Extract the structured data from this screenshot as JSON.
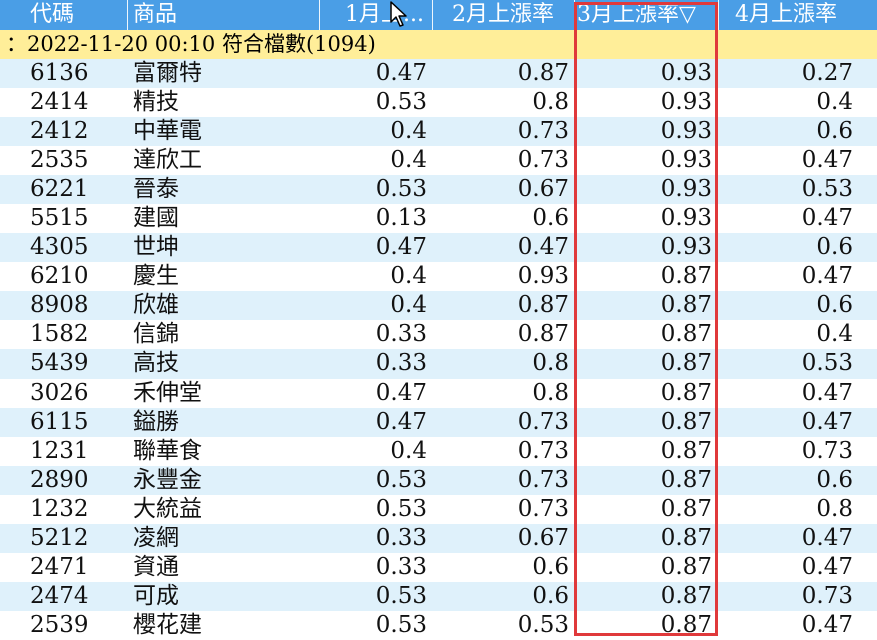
{
  "columns": {
    "code": "代碼",
    "name": "商品",
    "m1": "1月上...",
    "m2": "2月上漲率",
    "m3": "3月上漲率▽",
    "m4": "4月上漲率"
  },
  "banner": "：2022-11-20 00:10 符合檔數(1094)",
  "rows": [
    {
      "code": "6136",
      "name": "富爾特",
      "m1": "0.47",
      "m2": "0.87",
      "m3": "0.93",
      "m4": "0.27"
    },
    {
      "code": "2414",
      "name": "精技",
      "m1": "0.53",
      "m2": "0.8",
      "m3": "0.93",
      "m4": "0.4"
    },
    {
      "code": "2412",
      "name": "中華電",
      "m1": "0.4",
      "m2": "0.73",
      "m3": "0.93",
      "m4": "0.6"
    },
    {
      "code": "2535",
      "name": "達欣工",
      "m1": "0.4",
      "m2": "0.73",
      "m3": "0.93",
      "m4": "0.47"
    },
    {
      "code": "6221",
      "name": "晉泰",
      "m1": "0.53",
      "m2": "0.67",
      "m3": "0.93",
      "m4": "0.53"
    },
    {
      "code": "5515",
      "name": "建國",
      "m1": "0.13",
      "m2": "0.6",
      "m3": "0.93",
      "m4": "0.47"
    },
    {
      "code": "4305",
      "name": "世坤",
      "m1": "0.47",
      "m2": "0.47",
      "m3": "0.93",
      "m4": "0.6"
    },
    {
      "code": "6210",
      "name": "慶生",
      "m1": "0.4",
      "m2": "0.93",
      "m3": "0.87",
      "m4": "0.47"
    },
    {
      "code": "8908",
      "name": "欣雄",
      "m1": "0.4",
      "m2": "0.87",
      "m3": "0.87",
      "m4": "0.6"
    },
    {
      "code": "1582",
      "name": "信錦",
      "m1": "0.33",
      "m2": "0.87",
      "m3": "0.87",
      "m4": "0.4"
    },
    {
      "code": "5439",
      "name": "高技",
      "m1": "0.33",
      "m2": "0.8",
      "m3": "0.87",
      "m4": "0.53"
    },
    {
      "code": "3026",
      "name": "禾伸堂",
      "m1": "0.47",
      "m2": "0.8",
      "m3": "0.87",
      "m4": "0.47"
    },
    {
      "code": "6115",
      "name": "鎰勝",
      "m1": "0.47",
      "m2": "0.73",
      "m3": "0.87",
      "m4": "0.47"
    },
    {
      "code": "1231",
      "name": "聯華食",
      "m1": "0.4",
      "m2": "0.73",
      "m3": "0.87",
      "m4": "0.73"
    },
    {
      "code": "2890",
      "name": "永豐金",
      "m1": "0.53",
      "m2": "0.73",
      "m3": "0.87",
      "m4": "0.6"
    },
    {
      "code": "1232",
      "name": "大統益",
      "m1": "0.53",
      "m2": "0.73",
      "m3": "0.87",
      "m4": "0.8"
    },
    {
      "code": "5212",
      "name": "凌網",
      "m1": "0.33",
      "m2": "0.67",
      "m3": "0.87",
      "m4": "0.47"
    },
    {
      "code": "2471",
      "name": "資通",
      "m1": "0.33",
      "m2": "0.6",
      "m3": "0.87",
      "m4": "0.47"
    },
    {
      "code": "2474",
      "name": "可成",
      "m1": "0.53",
      "m2": "0.6",
      "m3": "0.87",
      "m4": "0.73"
    },
    {
      "code": "2539",
      "name": "櫻花建",
      "m1": "0.53",
      "m2": "0.53",
      "m3": "0.87",
      "m4": "0.47"
    }
  ],
  "icons": {
    "cursor": "mouse-pointer-icon"
  },
  "colors": {
    "header_bg": "#4a9ee6",
    "banner_bg": "#ffee99",
    "row_alt_bg": "#dff1fb",
    "highlight_border": "#e0393b"
  }
}
